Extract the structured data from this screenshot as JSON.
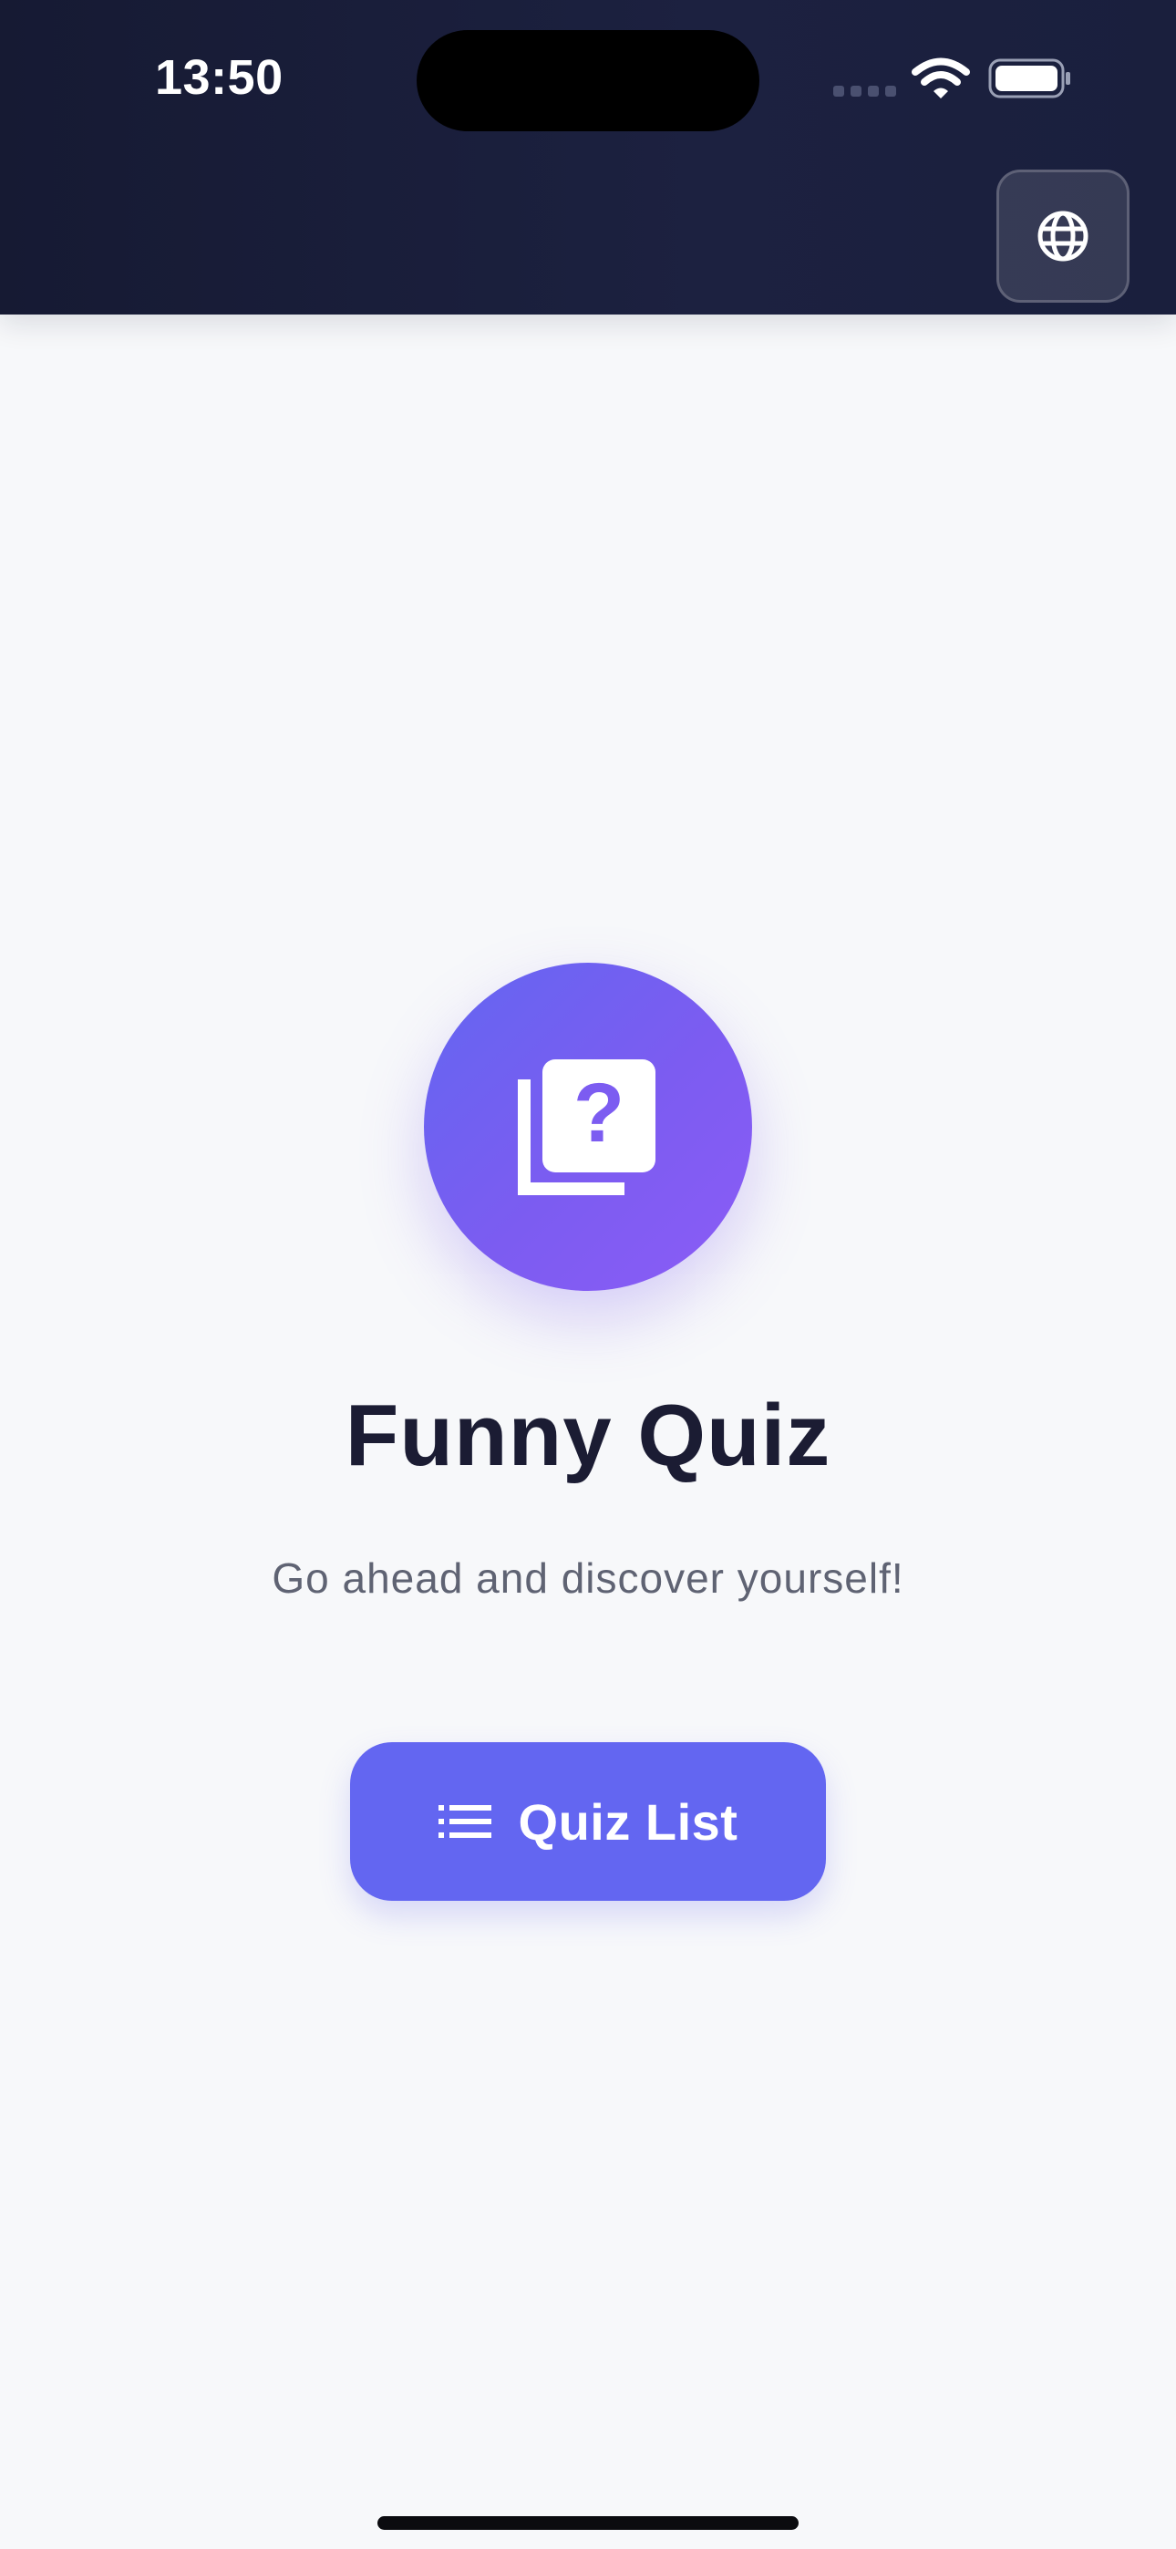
{
  "status_bar": {
    "time": "13:50",
    "icons": [
      "cellular-signal-icon",
      "wifi-icon",
      "battery-icon"
    ]
  },
  "header": {
    "language_button_icon": "globe-icon"
  },
  "hero": {
    "icon": "quiz-library-icon",
    "title": "Funny Quiz",
    "subtitle": "Go ahead and discover yourself!"
  },
  "actions": {
    "quiz_list_icon": "list-icon",
    "quiz_list_label": "Quiz List"
  },
  "colors": {
    "header_background": "#1a1f3d",
    "page_background": "#f7f8fa",
    "accent": "#6366f1",
    "accent_secondary": "#8b5cf6",
    "title_text": "#1b1c33",
    "subtitle_text": "#5f6373"
  }
}
